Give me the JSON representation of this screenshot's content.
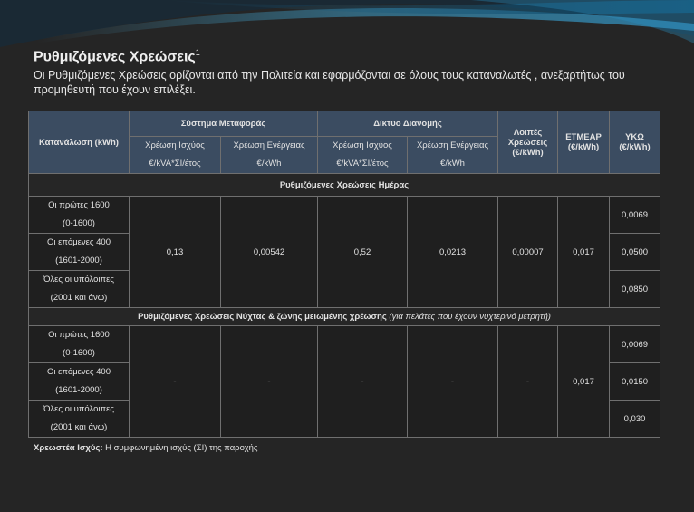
{
  "heading": {
    "title": "Ρυθμιζόμενες Χρεώσεις",
    "sup": "1"
  },
  "intro": "Οι Ρυθμιζόμενες Χρεώσεις ορίζονται από την Πολιτεία και εφαρμόζονται σε όλους τους καταναλωτές , ανεξαρτήτως του προμηθευτή που έχουν επιλέξει.",
  "table": {
    "headers": {
      "consumption": "Κατανάλωση (kWh)",
      "transmission": "Σύστημα Μεταφοράς",
      "distribution": "Δίκτυο Διανομής",
      "other": "Λοιπές Χρεώσεις (€/kWh)",
      "etmear": "ΕΤΜΕΑΡ (€/kWh)",
      "yko": "ΥΚΩ (€/kWh)",
      "power_charge": "Χρέωση Ισχύος",
      "energy_charge": "Χρέωση Ενέργειας",
      "power_unit": "€/kVA*ΣΙ/έτος",
      "energy_unit": "€/kWh"
    },
    "day": {
      "section_title": "Ρυθμιζόμενες Χρεώσεις Ημέρας",
      "tiers": [
        {
          "l1": "Οι πρώτες 1600",
          "l2": "(0-1600)",
          "yko": "0,0069"
        },
        {
          "l1": "Οι επόμενες 400",
          "l2": "(1601-2000)",
          "yko": "0,0500"
        },
        {
          "l1": "Όλες οι υπόλοιπες",
          "l2": "(2001 και άνω)",
          "yko": "0,0850"
        }
      ],
      "trans_power": "0,13",
      "trans_energy": "0,00542",
      "dist_power": "0,52",
      "dist_energy": "0,0213",
      "other": "0,00007",
      "etmear": "0,017"
    },
    "night": {
      "section_title": "Ρυθμιζόμενες Χρεώσεις Νύχτας & ζώνης μειωμένης χρέωσης",
      "section_note": "(για πελάτες που έχουν νυχτερινό μετρητή)",
      "tiers": [
        {
          "l1": "Οι πρώτες 1600",
          "l2": "(0-1600)",
          "yko": "0,0069"
        },
        {
          "l1": "Οι επόμενες 400",
          "l2": "(1601-2000)",
          "yko": "0,0150"
        },
        {
          "l1": "Όλες οι υπόλοιπες",
          "l2": "(2001 και άνω)",
          "yko": "0,030"
        }
      ],
      "trans_power": "-",
      "trans_energy": "-",
      "dist_power": "-",
      "dist_energy": "-",
      "other": "-",
      "etmear": "0,017"
    }
  },
  "footer": {
    "label": "Χρεωστέα Ισχύς:",
    "text": "Η συμφωνημένη ισχύς (ΣΙ) της παροχής"
  },
  "colors": {
    "background": "#252525",
    "header": "#3b4c61",
    "accent": "#2a8fb8"
  }
}
